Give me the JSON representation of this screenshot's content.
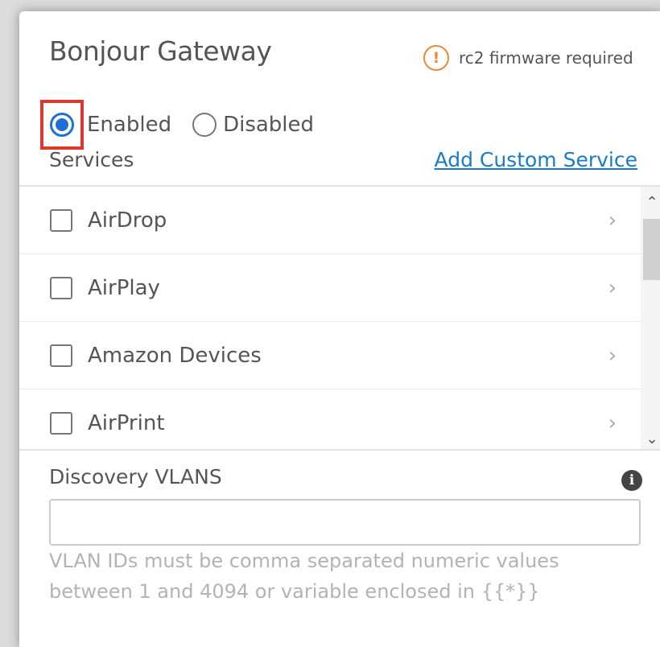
{
  "header": {
    "title": "Bonjour Gateway",
    "firmware_note": "rc2 firmware required",
    "warning_glyph": "!"
  },
  "mode": {
    "selected": "Enabled",
    "options": [
      {
        "label": "Enabled",
        "checked": true
      },
      {
        "label": "Disabled",
        "checked": false
      }
    ]
  },
  "services": {
    "label": "Services",
    "add_link": "Add Custom Service",
    "items": [
      {
        "label": "AirDrop",
        "checked": false
      },
      {
        "label": "AirPlay",
        "checked": false
      },
      {
        "label": "Amazon Devices",
        "checked": false
      },
      {
        "label": "AirPrint",
        "checked": false
      }
    ],
    "chevron": "›",
    "scroll_up": "⌃",
    "scroll_down": "⌄"
  },
  "vlans": {
    "label": "Discovery VLANS",
    "info_glyph": "i",
    "value": "",
    "placeholder": "",
    "help": "VLAN IDs must be comma separated numeric values between 1 and 4094 or variable enclosed in {{*}}"
  },
  "colors": {
    "accent": "#1f6fd8",
    "link": "#1a7bc9",
    "warning": "#f0883a",
    "highlight_box": "#d9392f"
  }
}
